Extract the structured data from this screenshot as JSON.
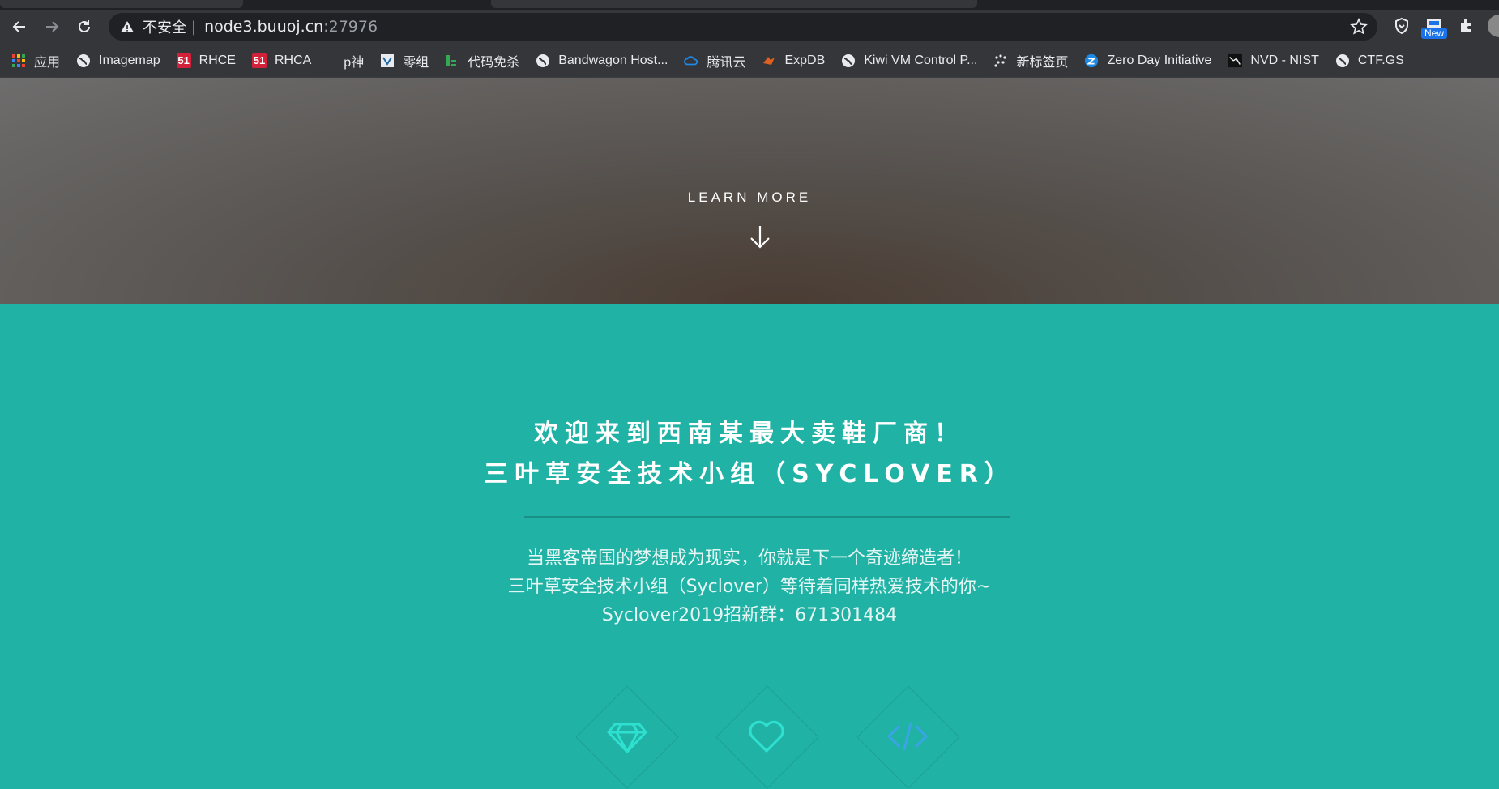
{
  "browser": {
    "insecure_label": "不安全",
    "separator": "|",
    "url_host": "node3.buuoj.cn",
    "url_port": ":27976",
    "extension_badge": "New",
    "icons": [
      "back-icon",
      "forward-icon",
      "reload-icon",
      "warning-icon",
      "star-icon",
      "shield-icon",
      "puzzle-icon"
    ]
  },
  "bookmarks": [
    {
      "label": "应用",
      "icon": "apps-grid-icon"
    },
    {
      "label": "Imagemap",
      "icon": "globe-icon"
    },
    {
      "label": "RHCE",
      "icon": "51-icon",
      "icon_text": "51"
    },
    {
      "label": "RHCA",
      "icon": "51-icon",
      "icon_text": "51"
    },
    {
      "label": "p神",
      "icon": "blank-icon"
    },
    {
      "label": "零组",
      "icon": "zero-group-icon"
    },
    {
      "label": "代码免杀",
      "icon": "bar-icon"
    },
    {
      "label": "Bandwagon Host...",
      "icon": "globe-icon"
    },
    {
      "label": "腾讯云",
      "icon": "cloud-icon"
    },
    {
      "label": "ExpDB",
      "icon": "exploit-icon"
    },
    {
      "label": "Kiwi VM Control P...",
      "icon": "globe-icon"
    },
    {
      "label": "新标签页",
      "icon": "dots-icon"
    },
    {
      "label": "Zero Day Initiative",
      "icon": "zdi-icon"
    },
    {
      "label": "NVD - NIST",
      "icon": "nvd-icon"
    },
    {
      "label": "CTF.GS",
      "icon": "globe-icon"
    }
  ],
  "hero": {
    "learn_more": "LEARN MORE"
  },
  "section": {
    "title_line1": "欢迎来到西南某最大卖鞋厂商！",
    "title_line2": "三叶草安全技术小组（SYCLOVER）",
    "desc_line1": "当黑客帝国的梦想成为现实，你就是下一个奇迹缔造者！",
    "desc_line2": "三叶草安全技术小组（Syclover）等待着同样热爱技术的你~",
    "desc_line3": "Syclover2019招新群：671301484",
    "feature_icons": [
      "diamond-icon",
      "heart-icon",
      "code-icon"
    ]
  },
  "colors": {
    "accent": "#21b2a6",
    "feature_icon": "#2de0d0",
    "chrome_bg": "#35363a"
  }
}
